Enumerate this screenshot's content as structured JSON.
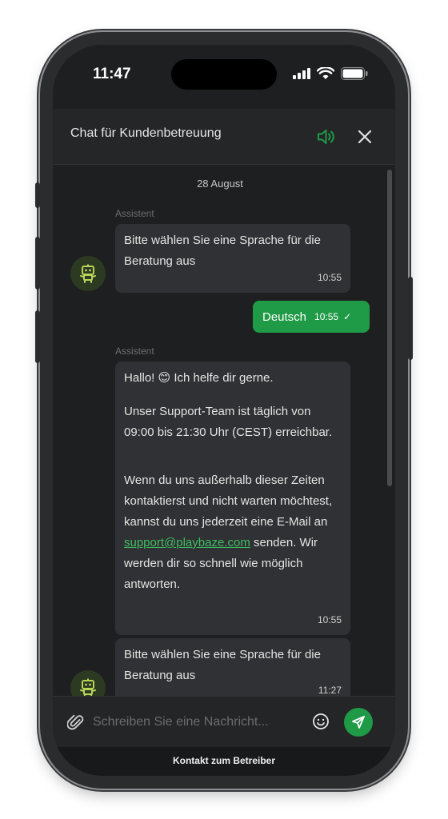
{
  "status": {
    "time": "11:47"
  },
  "header": {
    "title": "Chat für Kundenbetreuung"
  },
  "messages": {
    "date": "28 August",
    "bot1": {
      "sender": "Assistent",
      "text": "Bitte wählen Sie eine Sprache für die Beratung aus",
      "time": "10:55"
    },
    "user1": {
      "text": "Deutsch",
      "time": "10:55",
      "status": "✓"
    },
    "bot2": {
      "sender": "Assistent",
      "greeting": "Hallo! 😊 Ich helfe dir gerne.",
      "para2": "Unser Support-Team ist täglich von 09:00 bis 21:30 Uhr (CEST) erreichbar.",
      "para3_before": "Wenn du uns außerhalb dieser Zeiten kontaktierst und nicht warten möchtest, kannst du uns jederzeit eine E-Mail an",
      "email": "support@playbaze.com",
      "para3_after": "senden. Wir werden dir so schnell wie möglich antworten.",
      "time": "10:55"
    },
    "bot3": {
      "text": "Bitte wählen Sie eine Sprache für die Beratung aus",
      "time": "11:27"
    }
  },
  "composer": {
    "placeholder": "Schreiben Sie eine Nachricht..."
  },
  "footer": {
    "label": "Kontakt zum Betreiber"
  },
  "colors": {
    "accent": "#1f9a46",
    "link": "#3fbe62",
    "background": "#1e1f21",
    "bubble": "#303134"
  },
  "icons": {
    "sound": "speaker-icon",
    "close": "close-icon",
    "avatar": "robot-icon",
    "attach": "paperclip-icon",
    "emoji": "smiley-icon",
    "send": "send-icon"
  }
}
